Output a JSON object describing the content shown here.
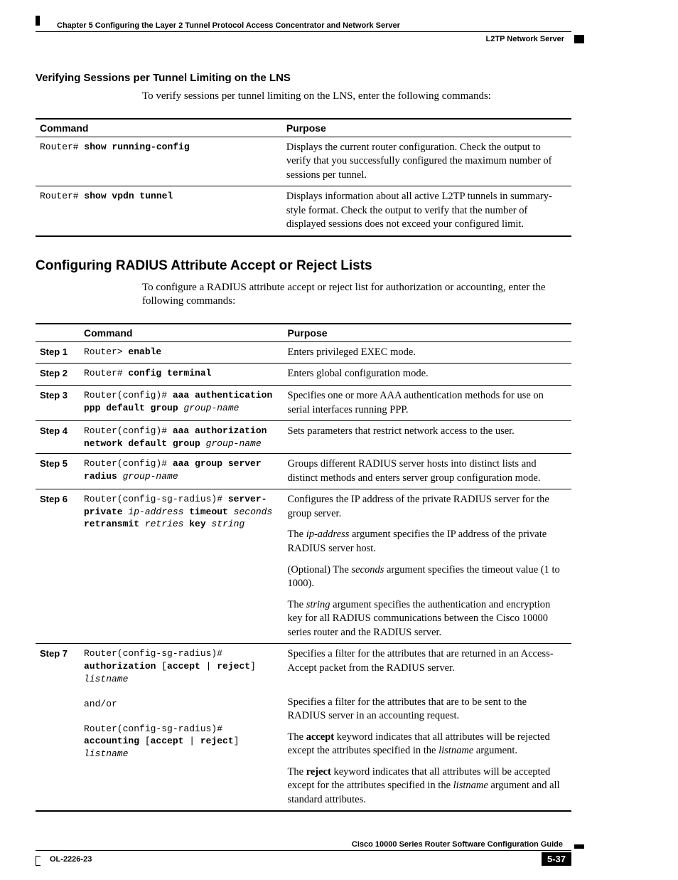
{
  "header": {
    "chapter": "Chapter 5      Configuring the Layer 2 Tunnel Protocol Access Concentrator and Network Server",
    "section": "L2TP Network Server"
  },
  "section1": {
    "title": "Verifying Sessions per Tunnel Limiting on the LNS",
    "intro": "To verify sessions per tunnel limiting on the LNS, enter the following commands:",
    "header_cmd": "Command",
    "header_purpose": "Purpose",
    "rows": [
      {
        "prompt": "Router# ",
        "cmd": "show running-config",
        "purpose": "Displays the current router configuration. Check the output to verify that you successfully configured the maximum number of sessions per tunnel."
      },
      {
        "prompt": "Router# ",
        "cmd": "show vpdn tunnel",
        "purpose": "Displays information about all active L2TP tunnels in summary-style format. Check the output to verify that the number of displayed sessions does not exceed your configured limit."
      }
    ]
  },
  "section2": {
    "title": "Configuring RADIUS Attribute Accept or Reject Lists",
    "intro": "To configure a RADIUS attribute accept or reject list for authorization or accounting, enter the following commands:",
    "header_cmd": "Command",
    "header_purpose": "Purpose",
    "steps": [
      {
        "label": "Step 1",
        "cmd_html": "Router> <b>enable</b>",
        "purpose_html": "Enters privileged EXEC mode."
      },
      {
        "label": "Step 2",
        "cmd_html": "Router# <b>config terminal</b>",
        "purpose_html": "Enters global configuration mode."
      },
      {
        "label": "Step 3",
        "cmd_html": "Router(config)# <b>aaa authentication ppp default group</b> <i>group-name</i>",
        "purpose_html": "Specifies one or more AAA authentication methods for use on serial interfaces running PPP."
      },
      {
        "label": "Step 4",
        "cmd_html": "Router(config)# <b>aaa authorization network default group</b> <i>group-name</i>",
        "purpose_html": "Sets parameters that restrict network access to the user."
      },
      {
        "label": "Step 5",
        "cmd_html": "Router(config)# <b>aaa group server radius</b> <i>group-name</i>",
        "purpose_html": "Groups different RADIUS server hosts into distinct lists and distinct methods and enters server group configuration mode."
      },
      {
        "label": "Step 6",
        "cmd_html": "Router(config-sg-radius)# <b>server-private</b> <i>ip-address</i> <b>timeout</b> <i>seconds</i> <b>retransmit</b> <i>retries</i> <b>key</b> <i>string</i>",
        "purpose_html": "<p>Configures the IP address of the private RADIUS server for the group server.</p><p>The <i>ip-address</i> argument specifies the IP address of the private RADIUS server host.</p><p>(Optional) The <i>seconds</i> argument specifies the timeout value (1 to 1000).</p><p>The <i>string</i> argument specifies the authentication and encryption key for all RADIUS communications between the Cisco 10000 series router and the RADIUS server.</p>"
      },
      {
        "label": "Step 7",
        "cmd_html": "Router(config-sg-radius)# <b>authorization</b> [<b>accept</b> | <b>reject</b>] <i>listname</i><br><br>and/or<br><br>Router(config-sg-radius)# <b>accounting</b> [<b>accept</b> | <b>reject</b>] <i>listname</i>",
        "purpose_html": "<p>Specifies a filter for the attributes that are returned in an Access-Accept packet from the RADIUS server.</p><p style='margin-top:28px'>Specifies a filter for the attributes that are to be sent to the RADIUS server in an accounting request.</p><p>The <b>accept</b> keyword indicates that all attributes will be rejected except the attributes specified in the <i>listname</i> argument.</p><p>The <b>reject</b> keyword indicates that all attributes will be accepted except for the attributes specified in the <i>listname</i> argument and all standard attributes.</p>"
      }
    ]
  },
  "footer": {
    "guide": "Cisco 10000 Series Router Software Configuration Guide",
    "docnum": "OL-2226-23",
    "page": "5-37"
  }
}
